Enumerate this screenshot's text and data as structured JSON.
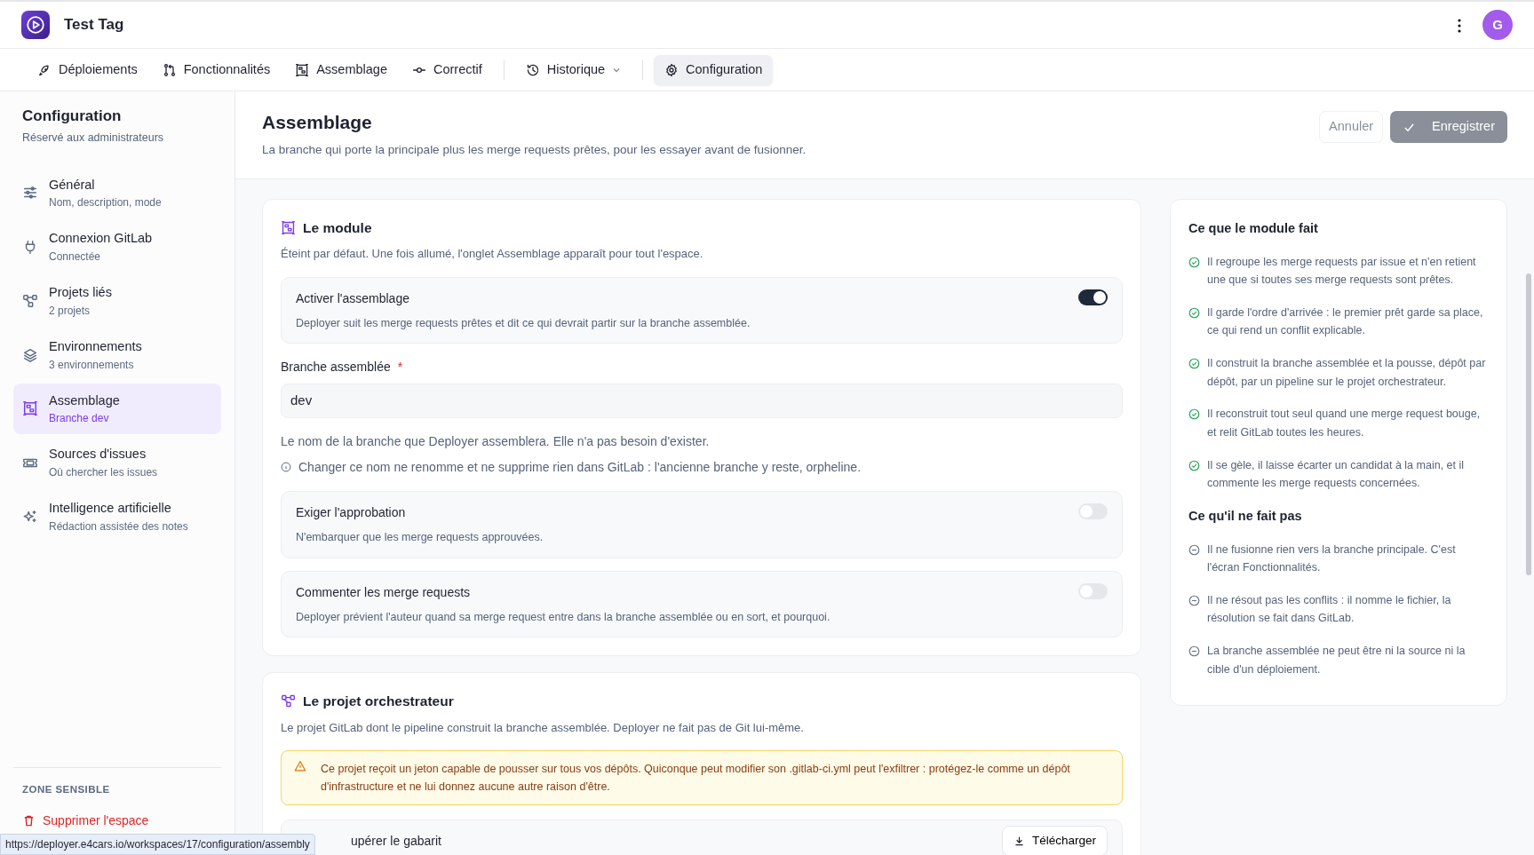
{
  "app": {
    "title": "Test Tag",
    "avatar": "G"
  },
  "nav_groups": [
    [
      {
        "label": "Déploiements",
        "selected": false,
        "dropdown": false
      },
      {
        "label": "Fonctionnalités",
        "selected": false,
        "dropdown": false
      },
      {
        "label": "Assemblage",
        "selected": false,
        "dropdown": false
      },
      {
        "label": "Correctif",
        "selected": false,
        "dropdown": false
      }
    ],
    [
      {
        "label": "Historique",
        "selected": false,
        "dropdown": true
      }
    ],
    [
      {
        "label": "Configuration",
        "selected": true,
        "dropdown": false
      }
    ]
  ],
  "sidebar": {
    "title": "Configuration",
    "subtitle": "Réservé aux administrateurs",
    "items": [
      {
        "label": "Général",
        "detail": "Nom, description, mode",
        "selected": false
      },
      {
        "label": "Connexion GitLab",
        "detail": "Connectée",
        "selected": false
      },
      {
        "label": "Projets liés",
        "detail": "2 projets",
        "selected": false
      },
      {
        "label": "Environnements",
        "detail": "3 environnements",
        "selected": false
      },
      {
        "label": "Assemblage",
        "detail": "Branche dev",
        "selected": true
      },
      {
        "label": "Sources d'issues",
        "detail": "Où chercher les issues",
        "selected": false
      },
      {
        "label": "Intelligence artificielle",
        "detail": "Rédaction assistée des notes",
        "selected": false
      }
    ],
    "danger_zone": {
      "heading": "ZONE SENSIBLE",
      "action": "Supprimer l'espace"
    }
  },
  "page": {
    "title": "Assemblage",
    "subtitle": "La branche qui porte la principale plus les merge requests prêtes, pour les essayer avant de fusionner.",
    "cancel": "Annuler",
    "save": {
      "label": "Enregistrer",
      "disabled": true
    }
  },
  "module_card": {
    "title": "Le module",
    "description": "Éteint par défaut. Une fois allumé, l'onglet Assemblage apparaît pour tout l'espace.",
    "enable": {
      "label": "Activer l'assemblage",
      "description": "Deployer suit les merge requests prêtes et dit ce qui devrait partir sur la branche assemblée.",
      "on": true
    },
    "field": {
      "label": "Branche assemblée",
      "required_mark": "*",
      "value": "dev",
      "help": "Le nom de la branche que Deployer assemblera. Elle n'a pas besoin d'exister.",
      "note": "Changer ce nom ne renomme et ne supprime rien dans GitLab : l'ancienne branche y reste, orpheline."
    },
    "toggles": [
      {
        "label": "Exiger l'approbation",
        "description": "N'embarquer que les merge requests approuvées.",
        "on": false
      },
      {
        "label": "Commenter les merge requests",
        "description": "Deployer prévient l'auteur quand sa merge request entre dans la branche assemblée ou en sort, et pourquoi.",
        "on": false
      }
    ]
  },
  "orchestrator_card": {
    "title": "Le projet orchestrateur",
    "description": "Le projet GitLab dont le pipeline construit la branche assemblée. Deployer ne fait pas de Git lui-même.",
    "warning": "Ce projet reçoit un jeton capable de pousser sur tous vos dépôts. Quiconque peut modifier son .gitlab-ci.yml peut l'exfiltrer : protégez-le comme un dépôt d'infrastructure et ne lui donnez aucune autre raison d'être.",
    "template": {
      "label": "upérer le gabarit",
      "button": "Télécharger"
    }
  },
  "info_panel": [
    {
      "kind": "does",
      "heading": "Ce que le module fait",
      "items": [
        "Il regroupe les merge requests par issue et n'en retient une que si toutes ses merge requests sont prêtes.",
        "Il garde l'ordre d'arrivée : le premier prêt garde sa place, ce qui rend un conflit explicable.",
        "Il construit la branche assemblée et la pousse, dépôt par dépôt, par un pipeline sur le projet orchestrateur.",
        "Il reconstruit tout seul quand une merge request bouge, et relit GitLab toutes les heures.",
        "Il se gèle, il laisse écarter un candidat à la main, et il commente les merge requests concernées."
      ]
    },
    {
      "kind": "doesnt",
      "heading": "Ce qu'il ne fait pas",
      "items": [
        "Il ne fusionne rien vers la branche principale. C'est l'écran Fonctionnalités.",
        "Il ne résout pas les conflits : il nomme le fichier, la résolution se fait dans GitLab.",
        "La branche assemblée ne peut être ni la source ni la cible d'un déploiement."
      ]
    }
  ],
  "status_url": "https://deployer.e4cars.io/workspaces/17/configuration/assembly"
}
